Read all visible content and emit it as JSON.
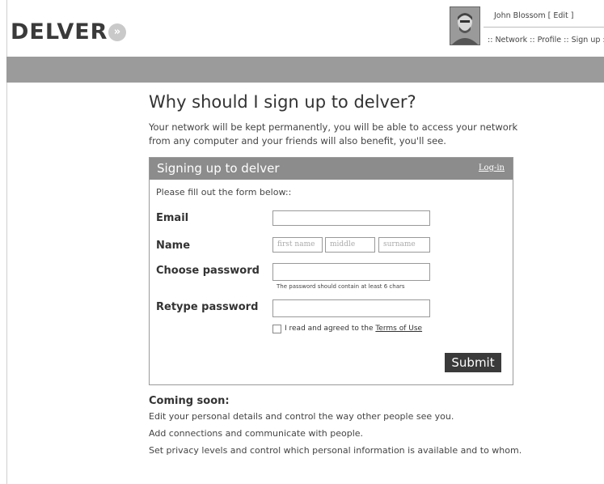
{
  "header": {
    "logo_text": "DELVER",
    "logo_mark": "»",
    "user_name": "John Blossom [ Edit ]",
    "nav_prefix": "::",
    "nav_items": [
      "Network",
      "Profile",
      "Sign up"
    ],
    "nav_sep": "::",
    "nav_suffix": "::"
  },
  "main": {
    "headline": "Why should I sign up to delver?",
    "intro": "Your network will be kept permanently, you will be able to access your network from any computer and your friends will also benefit, you'll see."
  },
  "form": {
    "title": "Signing up to delver",
    "login_link": "Log-in",
    "instruction": "Please fill out the form below::",
    "email_label": "Email",
    "name_label": "Name",
    "first_name_placeholder": "first name",
    "middle_placeholder": "middle",
    "surname_placeholder": "surname",
    "password_label": "Choose password",
    "password_hint": "The password should contain at least 6 chars",
    "retype_label": "Retype password",
    "terms_text": "I read and agreed to the",
    "terms_link": "Terms of Use",
    "submit_label": "Submit"
  },
  "coming_soon": {
    "title": "Coming soon:",
    "items": [
      "Edit your personal details and control the way other people see you.",
      "Add connections and communicate with people.",
      "Set privacy levels and control which personal information is available and to whom."
    ]
  },
  "colors": {
    "band": "#9b9b9b",
    "panel_header": "#8c8c8c",
    "submit_bg": "#3a3a3a"
  }
}
